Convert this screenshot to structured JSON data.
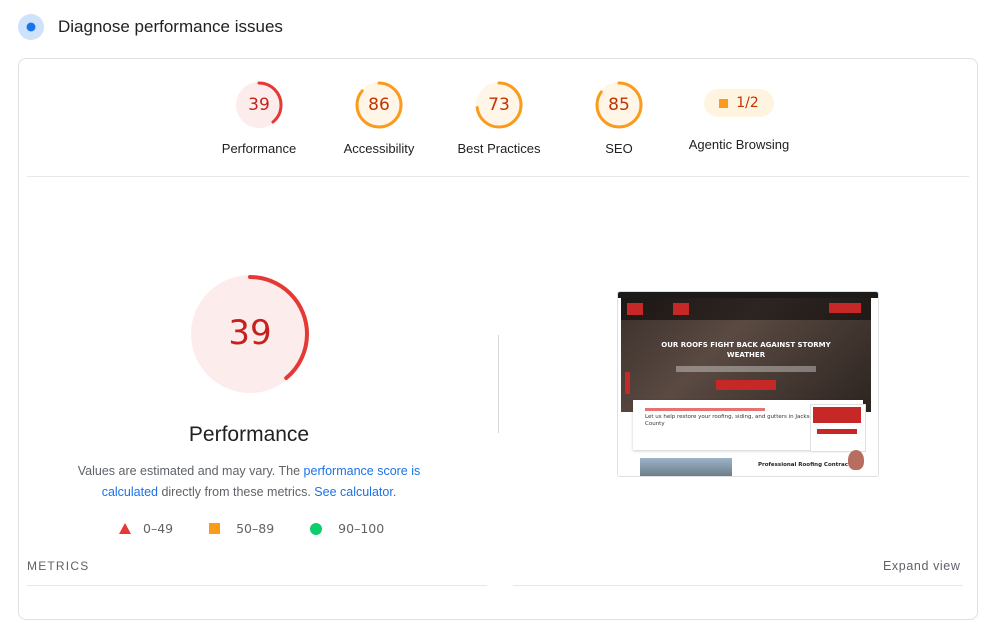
{
  "header": {
    "title": "Diagnose performance issues"
  },
  "gauges": [
    {
      "label": "Performance",
      "score": "39",
      "fraction": 0.39,
      "color": "#e53935",
      "bg": "#fdecec",
      "text_color": "#c5221f"
    },
    {
      "label": "Accessibility",
      "score": "86",
      "fraction": 0.86,
      "color": "#fa9b1b",
      "bg": "#fff6e8",
      "text_color": "#c33300"
    },
    {
      "label": "Best Practices",
      "score": "73",
      "fraction": 0.73,
      "color": "#fa9b1b",
      "bg": "#fff6e8",
      "text_color": "#c33300"
    },
    {
      "label": "SEO",
      "score": "85",
      "fraction": 0.85,
      "color": "#fa9b1b",
      "bg": "#fff6e8",
      "text_color": "#c33300"
    }
  ],
  "agentic": {
    "label": "Agentic Browsing",
    "value": "1/2"
  },
  "main": {
    "score": "39",
    "fraction": 0.39,
    "label": "Performance",
    "desc_pre": "Values are estimated and may vary. The ",
    "desc_link1": "performance score is calculated",
    "desc_mid": " directly from these metrics. ",
    "desc_link2": "See calculator",
    "desc_end": "."
  },
  "legend": [
    {
      "icon": "triangle-icon",
      "label": "0–49"
    },
    {
      "icon": "square-icon",
      "label": "50–89"
    },
    {
      "icon": "circle-icon",
      "label": "90–100"
    }
  ],
  "screenshot": {
    "headline": "OUR ROOFS FIGHT BACK AGAINST STORMY WEATHER",
    "card_text": "Let us help restore your roofing, siding, and gutters in Jackson County",
    "pro_text": "Professional Roofing Contractors"
  },
  "metrics": {
    "label": "METRICS",
    "expand": "Expand view"
  }
}
